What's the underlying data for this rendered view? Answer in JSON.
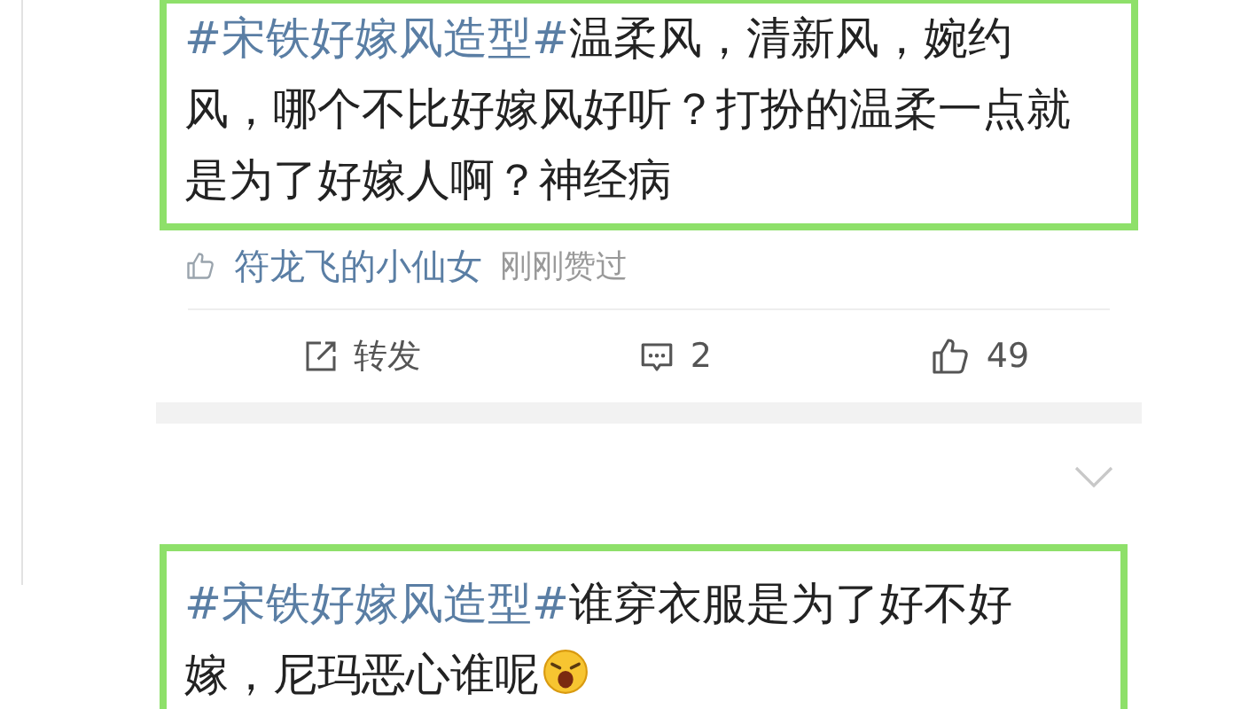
{
  "posts": [
    {
      "hashtag": "#宋铁好嫁风造型#",
      "text": "温柔风，清新风，婉约风，哪个不比好嫁风好听？打扮的温柔一点就是为了好嫁人啊？神经病",
      "trailing_emoji": false,
      "liked_by": {
        "name": "符龙飞的小仙女",
        "note": "刚刚赞过"
      },
      "actions": [
        {
          "kind": "repost",
          "label": "转发"
        },
        {
          "kind": "comment",
          "label": "2"
        },
        {
          "kind": "like",
          "label": "49"
        }
      ]
    },
    {
      "hashtag": "#宋铁好嫁风造型#",
      "text": "谁穿衣服是为了好不好嫁，尼玛恶心谁呢",
      "trailing_emoji": true
    }
  ]
}
